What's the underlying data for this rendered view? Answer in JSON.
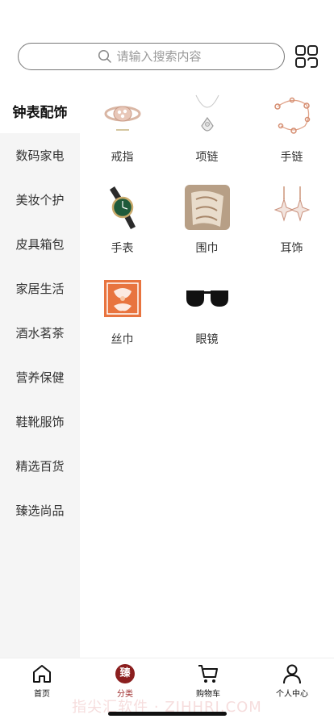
{
  "search": {
    "placeholder": "请输入搜索内容"
  },
  "sidebar": {
    "items": [
      {
        "label": "钟表配饰",
        "active": true
      },
      {
        "label": "数码家电"
      },
      {
        "label": "美妆个护"
      },
      {
        "label": "皮具箱包"
      },
      {
        "label": "家居生活"
      },
      {
        "label": "酒水茗茶"
      },
      {
        "label": "营养保健"
      },
      {
        "label": "鞋靴服饰"
      },
      {
        "label": "精选百货"
      },
      {
        "label": "臻选尚品"
      }
    ]
  },
  "categories": [
    {
      "label": "戒指",
      "icon": "ring-icon"
    },
    {
      "label": "项链",
      "icon": "necklace-icon"
    },
    {
      "label": "手链",
      "icon": "bracelet-icon"
    },
    {
      "label": "手表",
      "icon": "watch-icon"
    },
    {
      "label": "围巾",
      "icon": "scarf-icon"
    },
    {
      "label": "耳饰",
      "icon": "earrings-icon"
    },
    {
      "label": "丝巾",
      "icon": "silk-scarf-icon"
    },
    {
      "label": "眼镜",
      "icon": "sunglasses-icon"
    }
  ],
  "tabbar": {
    "items": [
      {
        "label": "首页",
        "icon": "home-icon"
      },
      {
        "label": "分类",
        "icon": "category-icon",
        "badge": "臻",
        "active": true
      },
      {
        "label": "购物车",
        "icon": "cart-icon"
      },
      {
        "label": "个人中心",
        "icon": "profile-icon"
      }
    ]
  },
  "watermark": "指尖汇软件 · ZJHHRJ.COM",
  "colors": {
    "accent": "#8b1f1f",
    "sidebar_bg": "#f5f5f5"
  }
}
